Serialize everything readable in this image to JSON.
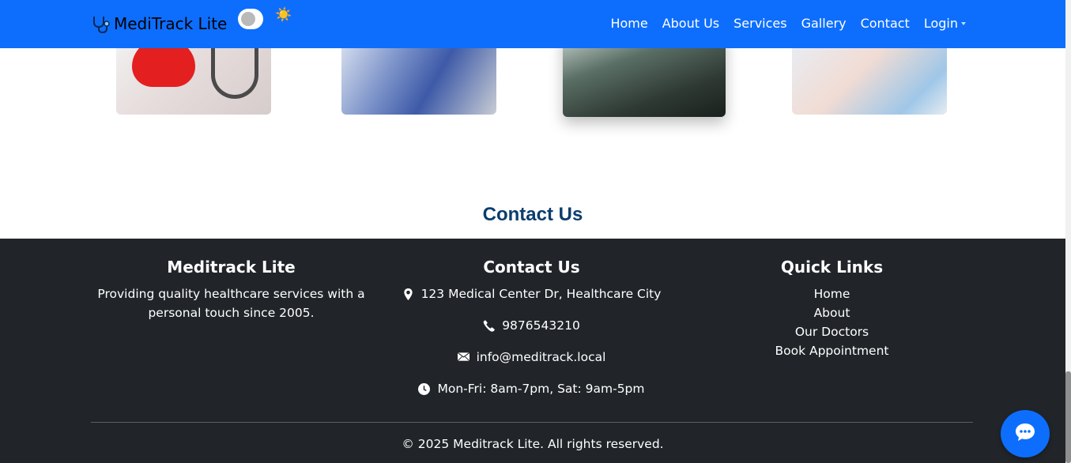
{
  "navbar": {
    "brand": "MediTrack Lite",
    "theme_icon": "☀️",
    "links": [
      "Home",
      "About Us",
      "Services",
      "Gallery",
      "Contact"
    ],
    "login": "Login"
  },
  "contact_section": {
    "title": "Contact Us"
  },
  "footer": {
    "about": {
      "title": "Meditrack Lite",
      "text": "Providing quality healthcare services with a personal touch since 2005."
    },
    "contact": {
      "title": "Contact Us",
      "address": "123 Medical Center Dr, Healthcare City",
      "phone": "9876543210",
      "email": "info@meditrack.local",
      "hours": "Mon-Fri: 8am-7pm, Sat: 9am-5pm"
    },
    "quick_links": {
      "title": "Quick Links",
      "items": [
        "Home",
        "About",
        "Our Doctors",
        "Book Appointment"
      ]
    },
    "copyright": "© 2025 Meditrack Lite. All rights reserved."
  },
  "colors": {
    "primary": "#0d6efd",
    "footer_bg": "#212529",
    "heading": "#0b3d6e"
  }
}
